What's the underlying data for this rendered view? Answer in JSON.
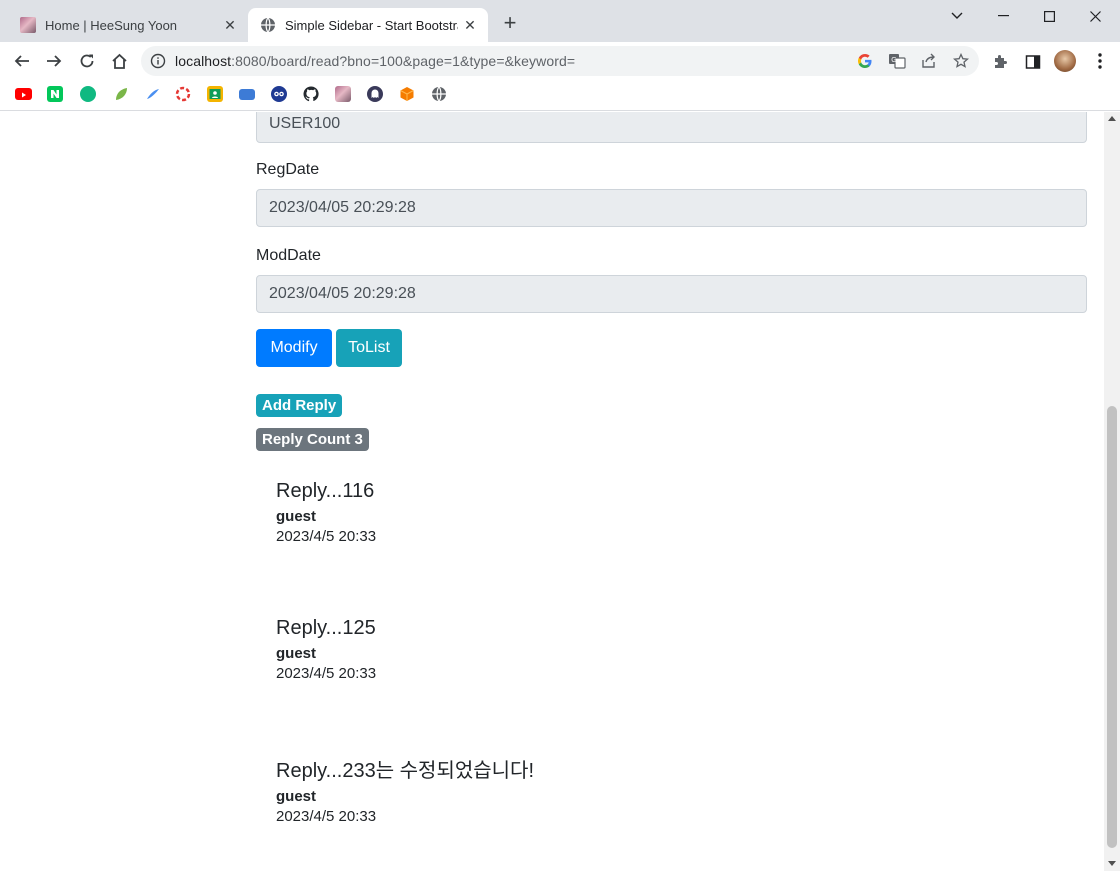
{
  "browser": {
    "tabs": [
      {
        "title": "Home | HeeSung Yoon",
        "active": false
      },
      {
        "title": "Simple Sidebar - Start Bootstrap",
        "active": true
      }
    ],
    "url_host": "localhost",
    "url_rest": ":8080/board/read?bno=100&page=1&type=&keyword=",
    "bookmarks": [
      {
        "icon": "youtube-icon",
        "color": "#ff0000"
      },
      {
        "icon": "naver-icon",
        "color": "#03c75a"
      },
      {
        "icon": "green-circle-icon",
        "color": "#10b981"
      },
      {
        "icon": "leaf-icon",
        "color": "#7ab648"
      },
      {
        "icon": "blue-feather-icon",
        "color": "#4a8ff0"
      },
      {
        "icon": "lifebuoy-icon",
        "color": "#e53935"
      },
      {
        "icon": "classroom-icon",
        "color": "#f4b400"
      },
      {
        "icon": "dbdiagram-icon",
        "color": "#3d7bd6"
      },
      {
        "icon": "owl-icon",
        "color": "#1f3a93"
      },
      {
        "icon": "github-icon",
        "color": "#24292e"
      },
      {
        "icon": "photo-icon",
        "color": "#b06a8a"
      },
      {
        "icon": "ghost-icon",
        "color": "#3a3a5a"
      },
      {
        "icon": "cube-icon",
        "color": "#f57c00"
      },
      {
        "icon": "globe-icon",
        "color": "#5f6368"
      }
    ]
  },
  "form": {
    "writer_value": "USER100",
    "regdate_label": "RegDate",
    "regdate_value": "2023/04/05 20:29:28",
    "moddate_label": "ModDate",
    "moddate_value": "2023/04/05 20:29:28"
  },
  "buttons": {
    "modify": "Modify",
    "tolist": "ToList"
  },
  "badges": {
    "add_reply": "Add Reply",
    "reply_count": "Reply Count 3"
  },
  "replies": [
    {
      "text": "Reply...116",
      "writer": "guest",
      "date": "2023/4/5 20:33"
    },
    {
      "text": "Reply...125",
      "writer": "guest",
      "date": "2023/4/5 20:33"
    },
    {
      "text": "Reply...233는 수정되었습니다!",
      "writer": "guest",
      "date": "2023/4/5 20:33"
    }
  ]
}
